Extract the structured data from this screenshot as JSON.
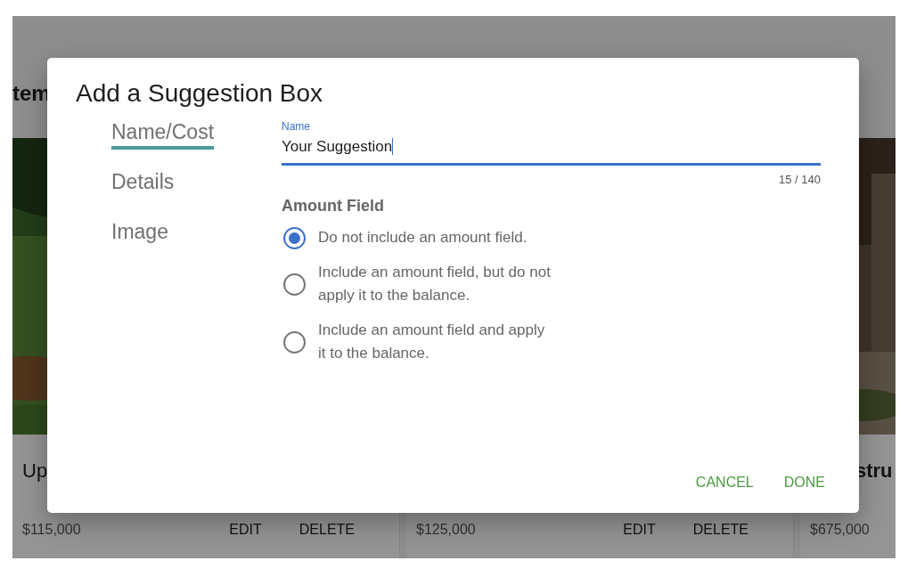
{
  "background": {
    "heading": "tem",
    "cards": [
      {
        "image": {
          "kind": "picture"
        },
        "title": "Up",
        "price": "$115,000",
        "actions": [
          "EDIT",
          "DELETE"
        ]
      },
      {
        "price": "$125,000",
        "actions": [
          "EDIT",
          "DELETE"
        ]
      },
      {
        "image": {
          "kind": "picture"
        },
        "title": "stru",
        "price": "$675,000"
      }
    ]
  },
  "dialog": {
    "title": "Add a Suggestion Box",
    "sections": [
      {
        "label": "Name/Cost",
        "selected": true
      },
      {
        "label": "Details",
        "selected": false
      },
      {
        "label": "Image",
        "selected": false
      }
    ],
    "name_field": {
      "label": "Name",
      "value": "Your Suggestion",
      "focused": true,
      "counter": "15 / 140"
    },
    "amount_field": {
      "heading": "Amount Field",
      "options": [
        {
          "label": "Do not include an amount field.",
          "selected": true
        },
        {
          "label": "Include an amount field, but do not apply it to the balance.",
          "selected": false
        },
        {
          "label": "Include an amount field and apply it to the balance.",
          "selected": false
        }
      ]
    },
    "buttons": [
      "CANCEL",
      "DONE"
    ]
  }
}
